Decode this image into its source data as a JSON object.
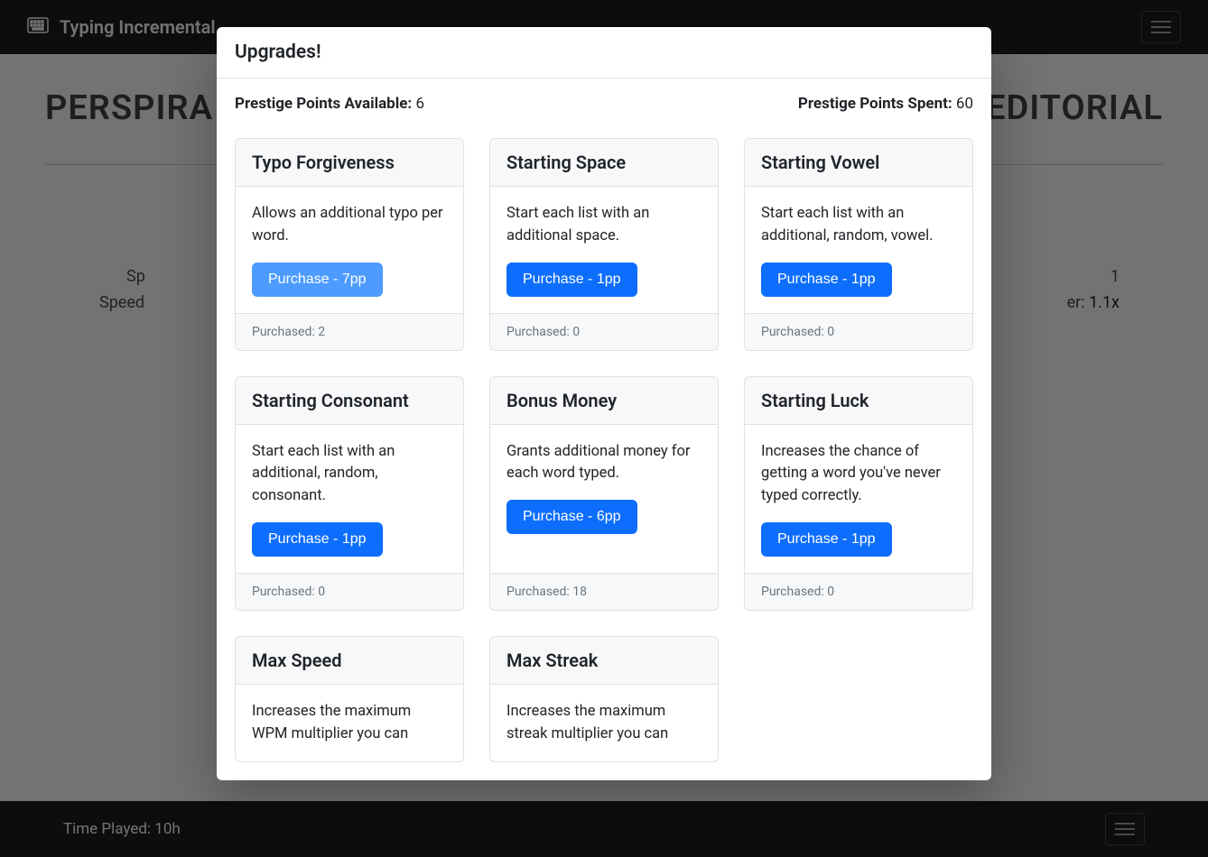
{
  "header": {
    "brand": "Typing Incremental"
  },
  "background": {
    "word_left": "PERSPIRA",
    "word_right": "EDITORIAL",
    "stats_left1_label": "Sp",
    "stats_left2_label": "Speed",
    "stats_right1": "",
    "stats_right2_label": "er:",
    "stats_right2_value": "1.1x"
  },
  "footer": {
    "time_played_label": "Time Played:",
    "time_played_value": "10h"
  },
  "modal": {
    "title": "Upgrades!",
    "pp_available_label": "Prestige Points Available:",
    "pp_available_value": "6",
    "pp_spent_label": "Prestige Points Spent:",
    "pp_spent_value": "60",
    "cards": [
      {
        "title": "Typo Forgiveness",
        "desc": "Allows an additional typo per word.",
        "cost": "Purchase - 7pp",
        "purchased": "Purchased: 2",
        "light": true,
        "show_foot": true
      },
      {
        "title": "Starting Space",
        "desc": "Start each list with an additional space.",
        "cost": "Purchase - 1pp",
        "purchased": "Purchased: 0",
        "light": false,
        "show_foot": true
      },
      {
        "title": "Starting Vowel",
        "desc": "Start each list with an additional, random, vowel.",
        "cost": "Purchase - 1pp",
        "purchased": "Purchased: 0",
        "light": false,
        "show_foot": true
      },
      {
        "title": "Starting Consonant",
        "desc": "Start each list with an additional, random, consonant.",
        "cost": "Purchase - 1pp",
        "purchased": "Purchased: 0",
        "light": false,
        "show_foot": true
      },
      {
        "title": "Bonus Money",
        "desc": "Grants additional money for each word typed.",
        "cost": "Purchase - 6pp",
        "purchased": "Purchased: 18",
        "light": false,
        "show_foot": true
      },
      {
        "title": "Starting Luck",
        "desc": "Increases the chance of getting a word you've never typed correctly.",
        "cost": "Purchase - 1pp",
        "purchased": "Purchased: 0",
        "light": false,
        "show_foot": true
      },
      {
        "title": "Max Speed",
        "desc": "Increases the maximum WPM multiplier you can",
        "cost": "",
        "purchased": "",
        "light": false,
        "show_foot": false
      },
      {
        "title": "Max Streak",
        "desc": "Increases the maximum streak multiplier you can",
        "cost": "",
        "purchased": "",
        "light": false,
        "show_foot": false
      }
    ]
  }
}
